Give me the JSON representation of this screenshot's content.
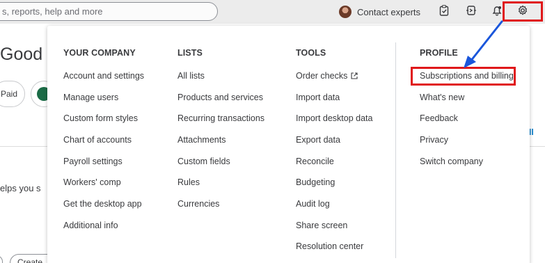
{
  "topbar": {
    "search_text": "s, reports, help and more",
    "contact_label": "Contact experts",
    "icons": [
      "clipboard-icon",
      "apps-icon",
      "bell-icon",
      "gear-icon"
    ]
  },
  "background": {
    "greeting": "Good",
    "pill_label": "Paid",
    "helps_text": "elps you s",
    "view_all": "ll",
    "create_label": "Create"
  },
  "menu": {
    "your_company": {
      "heading": "YOUR COMPANY",
      "items": [
        "Account and settings",
        "Manage users",
        "Custom form styles",
        "Chart of accounts",
        "Payroll settings",
        "Workers' comp",
        "Get the desktop app",
        "Additional info"
      ]
    },
    "lists": {
      "heading": "LISTS",
      "items": [
        "All lists",
        "Products and services",
        "Recurring transactions",
        "Attachments",
        "Custom fields",
        "Rules",
        "Currencies"
      ]
    },
    "tools": {
      "heading": "TOOLS",
      "items": [
        "Order checks",
        "Import data",
        "Import desktop data",
        "Export data",
        "Reconcile",
        "Budgeting",
        "Audit log",
        "Share screen",
        "Resolution center"
      ]
    },
    "profile": {
      "heading": "PROFILE",
      "items": [
        "Subscriptions and billing",
        "What's new",
        "Feedback",
        "Privacy",
        "Switch company"
      ]
    }
  },
  "annotation": {
    "highlight_color": "#e0181a",
    "arrow_color": "#1a56db"
  }
}
